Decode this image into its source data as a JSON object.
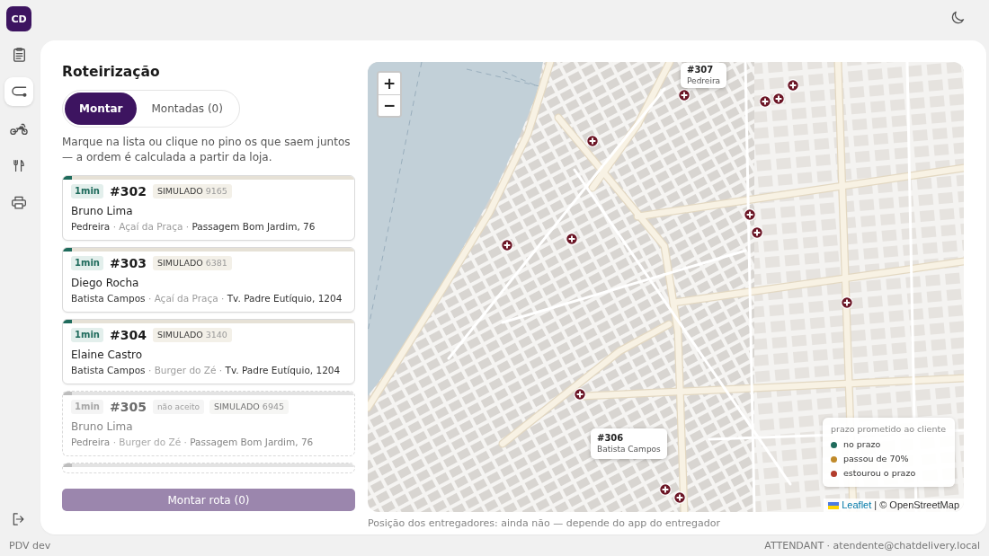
{
  "sidebar": {
    "logo": "CD",
    "items": [
      {
        "selected": false
      },
      {
        "selected": true
      },
      {
        "selected": false
      },
      {
        "selected": false
      },
      {
        "selected": false
      }
    ]
  },
  "panel": {
    "title": "Roteirização",
    "tabs": [
      {
        "label": "Montar",
        "selected": true
      },
      {
        "label": "Montadas (0)",
        "selected": false
      }
    ],
    "hint": "Marque na lista ou clique no pino os que saem juntos — a ordem é calculada a partir da loja.",
    "detail_separator": "·",
    "orders": [
      {
        "elapsed": "1min",
        "number": "#302",
        "accepted": true,
        "source": "SIMULADO",
        "code": "9165",
        "customer": "Bruno Lima",
        "district": "Pedreira",
        "store": "Açaí da Praça",
        "address": "Passagem Bom Jardim, 76",
        "level": 0.03
      },
      {
        "elapsed": "1min",
        "number": "#303",
        "accepted": true,
        "source": "SIMULADO",
        "code": "6381",
        "customer": "Diego Rocha",
        "district": "Batista Campos",
        "store": "Açaí da Praça",
        "address": "Tv. Padre Eutíquio, 1204",
        "level": 0.03
      },
      {
        "elapsed": "1min",
        "number": "#304",
        "accepted": true,
        "source": "SIMULADO",
        "code": "3140",
        "customer": "Elaine Castro",
        "district": "Batista Campos",
        "store": "Burger do Zé",
        "address": "Tv. Padre Eutíquio, 1204",
        "level": 0.03
      },
      {
        "elapsed": "1min",
        "number": "#305",
        "accepted": false,
        "status": "não aceito",
        "source": "SIMULADO",
        "code": "6945",
        "customer": "Bruno Lima",
        "district": "Pedreira",
        "store": "Burger do Zé",
        "address": "Passagem Bom Jardim, 76",
        "level": 0.03
      },
      {
        "accepted": false,
        "level": 0.03
      }
    ],
    "submit_button": {
      "label": "Montar rota (0)",
      "disabled": true
    }
  },
  "map": {
    "zoom_in": "+",
    "zoom_out": "−",
    "tooltips": [
      {
        "number": "#307",
        "district": "Pedreira"
      },
      {
        "number": "#306",
        "district": "Batista Campos"
      }
    ],
    "legend": {
      "title": "prazo prometido ao cliente",
      "items": [
        {
          "label": "no prazo",
          "color": "#1f6b5c"
        },
        {
          "label": "passou de 70%",
          "color": "#c08a2a"
        },
        {
          "label": "estourou o prazo",
          "color": "#b23c2c"
        }
      ]
    },
    "attribution": {
      "link": "Leaflet",
      "text": "| © OpenStreetMap"
    },
    "caption": "Posição dos entregadores: ainda não — depende do app do entregador"
  },
  "footer": {
    "left": "PDV dev",
    "right": "ATTENDANT · atendente@chatdelivery.local"
  }
}
